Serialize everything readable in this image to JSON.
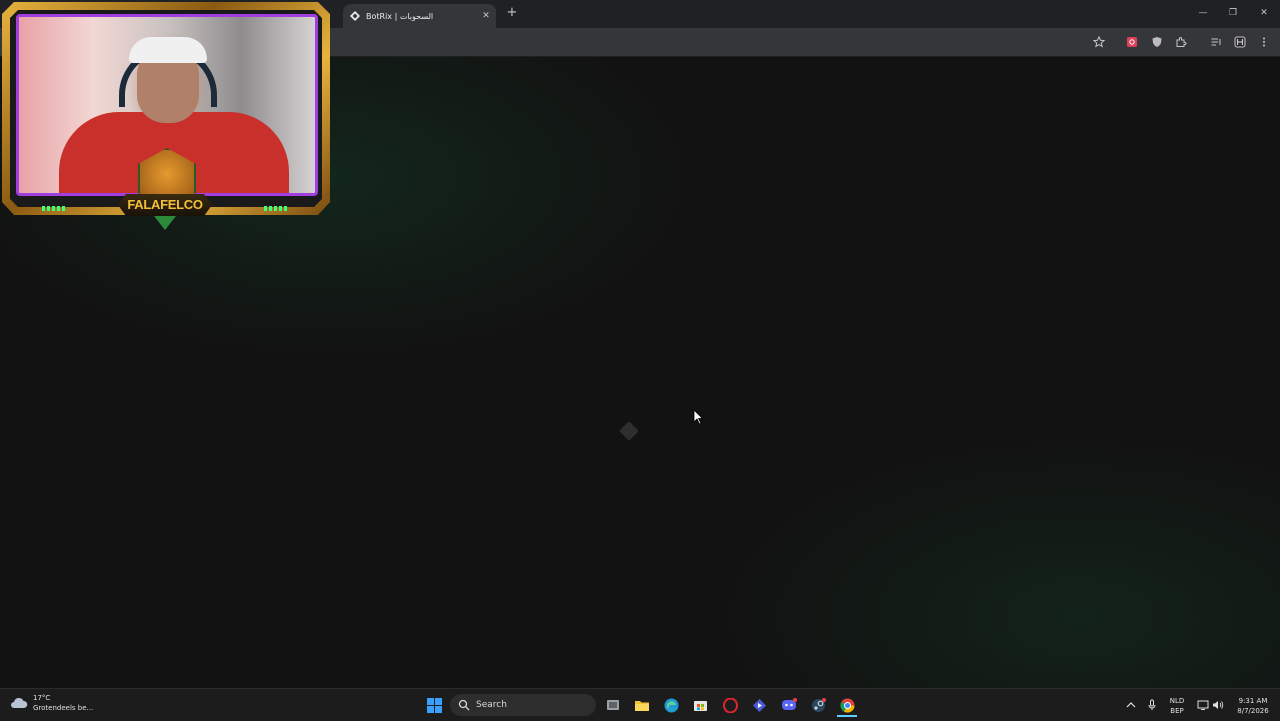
{
  "browser": {
    "tab": {
      "title": "BotRix | السحوبات",
      "close_glyph": "✕"
    },
    "new_tab_glyph": "+",
    "window_controls": {
      "minimize": "—",
      "restore": "❐",
      "close": "✕"
    },
    "toolbar_icons": [
      "bookmark-star-icon",
      "extension-red-icon",
      "shield-extension-icon",
      "puzzle-extensions-icon",
      "media-controls-icon",
      "profile-icon",
      "menu-kebab-icon"
    ]
  },
  "webcam_overlay": {
    "brand_text": "FALAFELCO"
  },
  "taskbar": {
    "weather": {
      "temp": "17°C",
      "desc": "Grotendeels be..."
    },
    "search_label": "Search",
    "pinned_apps": [
      "windows-start-icon",
      "task-view-icon",
      "file-explorer-icon",
      "edge-icon",
      "store-icon",
      "opera-icon",
      "app-icon",
      "discord-icon",
      "steam-icon",
      "chrome-icon"
    ],
    "tray": {
      "lang_top": "NLD",
      "lang_bottom": "BEP",
      "time": "9:31 AM",
      "date": "8/7/2026"
    }
  },
  "colors": {
    "accent_purple": "#a13ee0",
    "frame_gold": "#e7b33d",
    "background": "#121212",
    "led_green": "#3cff7a"
  }
}
